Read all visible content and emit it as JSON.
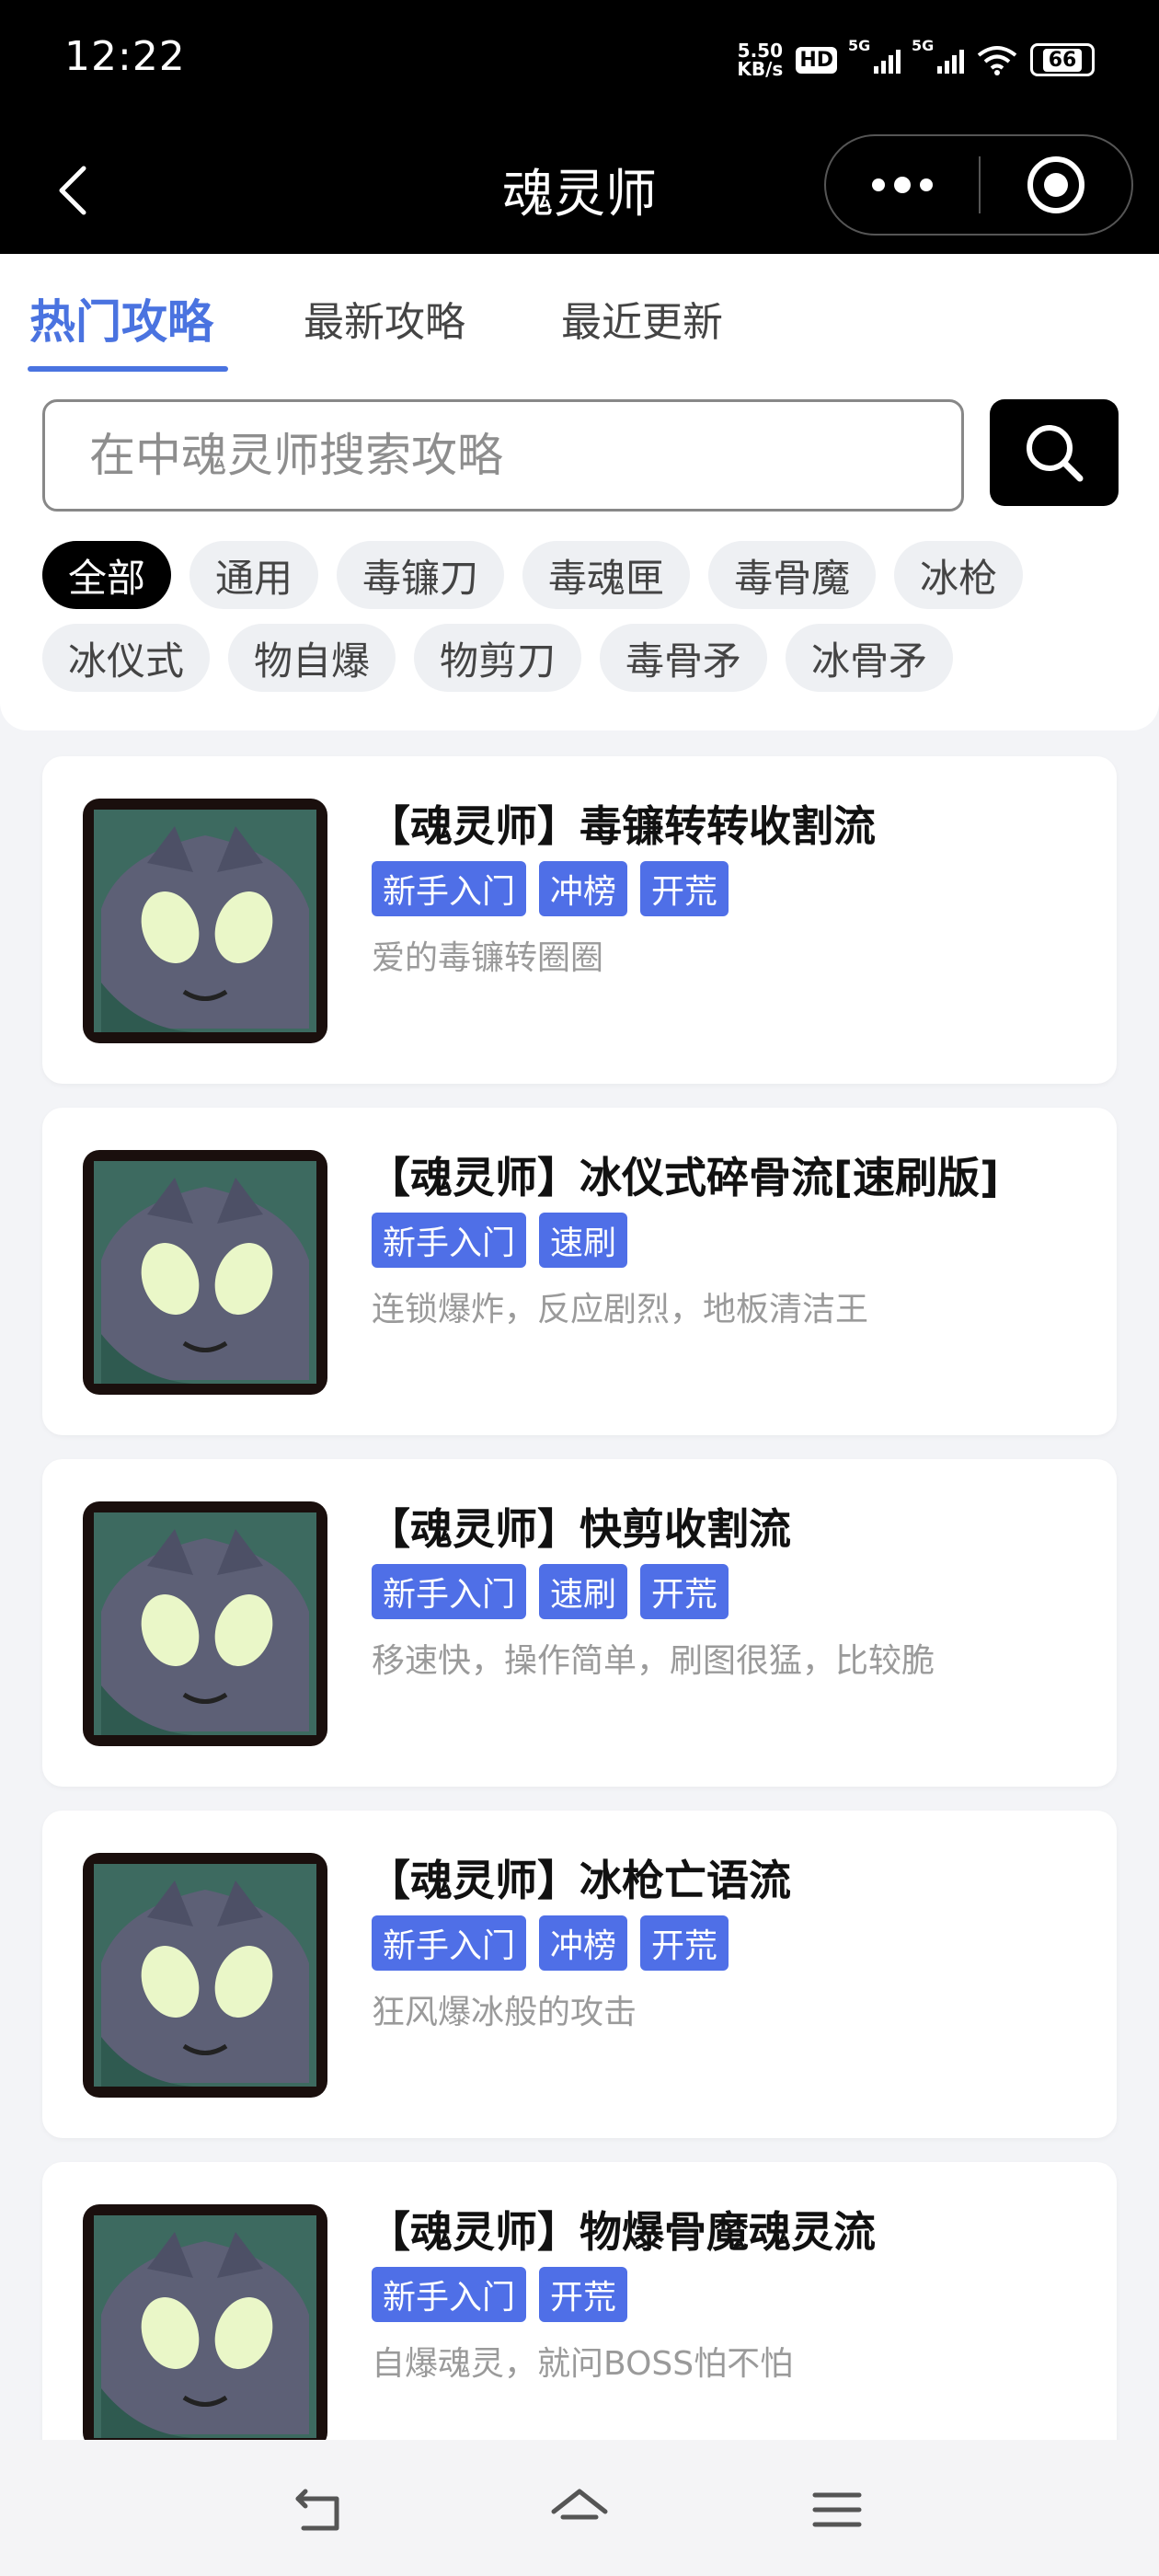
{
  "status_bar": {
    "time": "12:22",
    "net_speed_value": "5.50",
    "net_speed_unit": "KB/s",
    "hd_badge": "HD",
    "signal_1_label": "5G",
    "signal_2_label": "5G",
    "battery": "66"
  },
  "header": {
    "title": "魂灵师",
    "back_icon": "chevron-left-icon",
    "more_icon": "more-dots-icon",
    "close_icon": "target-circle-icon"
  },
  "tabs": [
    {
      "label": "热门攻略",
      "active": true
    },
    {
      "label": "最新攻略",
      "active": false
    },
    {
      "label": "最近更新",
      "active": false
    }
  ],
  "search": {
    "placeholder": "在中魂灵师搜索攻略",
    "value": "",
    "button_icon": "search-icon"
  },
  "filters_row1": [
    "全部",
    "通用",
    "毒镰刀",
    "毒魂匣",
    "毒骨魔",
    "冰枪"
  ],
  "filters_row2": [
    "冰仪式",
    "物自爆",
    "物剪刀",
    "毒骨矛",
    "冰骨矛"
  ],
  "active_filter": "全部",
  "guides": [
    {
      "title": "【魂灵师】毒镰转转收割流",
      "tags": [
        "新手入门",
        "冲榜",
        "开荒"
      ],
      "desc": "爱的毒镰转圈圈"
    },
    {
      "title": "【魂灵师】冰仪式碎骨流[速刷版]",
      "tags": [
        "新手入门",
        "速刷"
      ],
      "desc": "连锁爆炸，反应剧烈，地板清洁王"
    },
    {
      "title": "【魂灵师】快剪收割流",
      "tags": [
        "新手入门",
        "速刷",
        "开荒"
      ],
      "desc": "移速快，操作简单，刷图很猛，比较脆"
    },
    {
      "title": "【魂灵师】冰枪亡语流",
      "tags": [
        "新手入门",
        "冲榜",
        "开荒"
      ],
      "desc": "狂风爆冰般的攻击"
    },
    {
      "title": "【魂灵师】物爆骨魔魂灵流",
      "tags": [
        "新手入门",
        "开荒"
      ],
      "desc": "自爆魂灵，就问BOSS怕不怕"
    }
  ],
  "colors": {
    "accent": "#4a73e0",
    "tag_bg": "#4f6fe7",
    "header_bg": "#000000",
    "page_bg": "#f3f4f7"
  },
  "nav_bar": {
    "back_icon": "back-arrow-icon",
    "home_icon": "home-icon",
    "menu_icon": "menu-icon"
  }
}
